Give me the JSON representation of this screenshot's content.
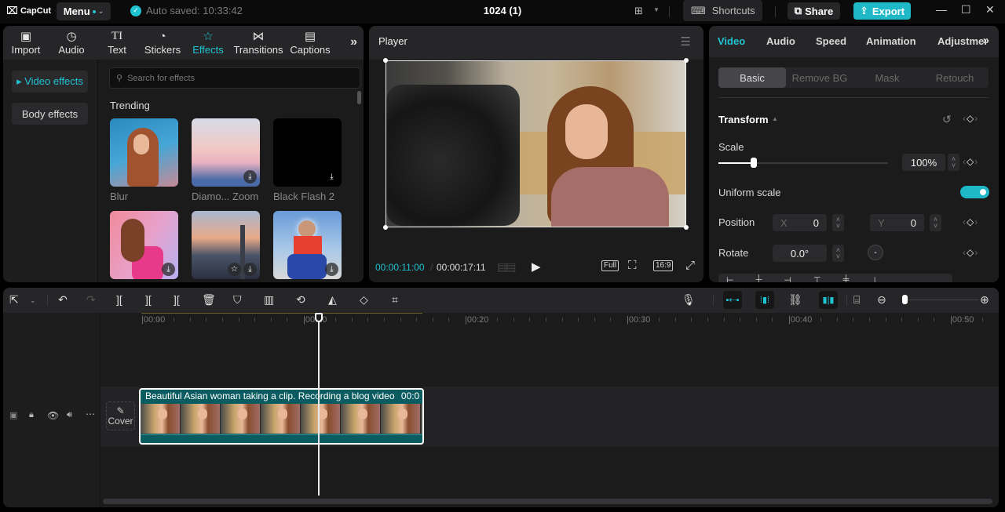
{
  "titlebar": {
    "app_name": "CapCut",
    "menu_label": "Menu",
    "autosave_text": "Auto saved: 10:33:42",
    "project_title": "1024 (1)",
    "shortcuts_label": "Shortcuts",
    "share_label": "Share",
    "export_label": "Export",
    "icons": {
      "layout": "layout-icon",
      "minimize": "minimize-icon",
      "maximize": "maximize-icon",
      "close": "close-icon"
    }
  },
  "toolbar_tabs": [
    {
      "label": "Import",
      "icon": "import-icon",
      "glyph": "▣"
    },
    {
      "label": "Audio",
      "icon": "audio-icon",
      "glyph": "♪"
    },
    {
      "label": "Text",
      "icon": "text-icon",
      "glyph": "TI"
    },
    {
      "label": "Stickers",
      "icon": "sticker-icon",
      "glyph": "◔"
    },
    {
      "label": "Effects",
      "icon": "effects-icon",
      "glyph": "☆",
      "active": true
    },
    {
      "label": "Transitions",
      "icon": "transitions-icon",
      "glyph": "⋈"
    },
    {
      "label": "Captions",
      "icon": "captions-icon",
      "glyph": "▤"
    }
  ],
  "effects_nav": [
    {
      "label": "▸ Video effects",
      "active": true
    },
    {
      "label": "Body effects"
    }
  ],
  "effects": {
    "search_placeholder": "Search for effects",
    "section_title": "Trending",
    "items": [
      {
        "label": "Blur",
        "download": false
      },
      {
        "label": "Diamo... Zoom",
        "download": true
      },
      {
        "label": "Black Flash 2",
        "download": true
      },
      {
        "label": "",
        "download": true
      },
      {
        "label": "",
        "download": true,
        "favorite": true
      },
      {
        "label": "",
        "download": true
      }
    ]
  },
  "player": {
    "title": "Player",
    "current_time": "00:00:11:00",
    "total_time": "00:00:17:11",
    "full_label": "Full",
    "ratio_label": "16:9"
  },
  "properties": {
    "tabs": [
      "Video",
      "Audio",
      "Speed",
      "Animation",
      "Adjustment"
    ],
    "active_tab": "Video",
    "subtabs": [
      "Basic",
      "Remove BG",
      "Mask",
      "Retouch"
    ],
    "active_subtab": "Basic",
    "transform_label": "Transform",
    "scale_label": "Scale",
    "scale_value": "100%",
    "scale_slider_fraction": 0.21,
    "uniform_scale_label": "Uniform scale",
    "uniform_scale_on": true,
    "position_label": "Position",
    "position_x_label": "X",
    "position_x": "0",
    "position_y_label": "Y",
    "position_y": "0",
    "rotate_label": "Rotate",
    "rotate_value": "0.0°"
  },
  "timeline": {
    "ruler_labels": [
      "|00:00",
      "|00:10",
      "|00:20",
      "|00:30",
      "|00:40",
      "|00:50"
    ],
    "clip_title": "Beautiful Asian woman taking a clip. Recording a blog video",
    "clip_duration": "00:0",
    "cover_label": "Cover",
    "zoom_fraction": 0.05
  },
  "colors": {
    "accent": "#1fc4d2",
    "export_bg": "#1fb8c6",
    "clip_bg": "#0b5c60"
  }
}
